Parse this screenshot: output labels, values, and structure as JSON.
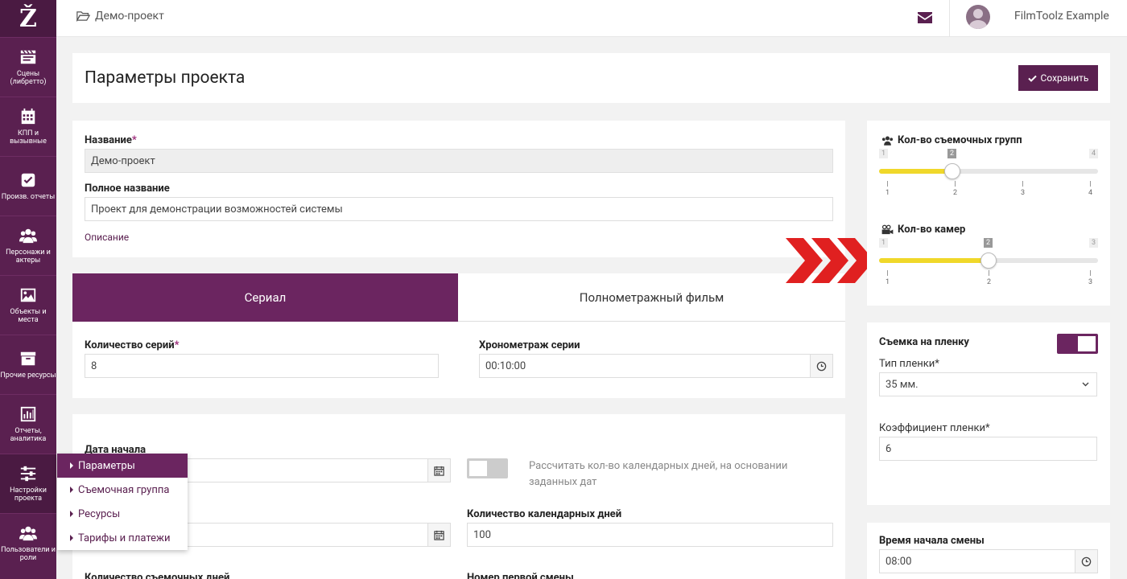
{
  "app": {
    "logo_letter": "Ž"
  },
  "sidebar": {
    "items": [
      {
        "icon": "clapperboard-icon",
        "label": "Сцены (либретто)"
      },
      {
        "icon": "calendar-icon",
        "label": "КПП и вызывные"
      },
      {
        "icon": "checkbox-icon",
        "label": "Произв. отчеты"
      },
      {
        "icon": "users-icon",
        "label": "Персонажи и актеры"
      },
      {
        "icon": "image-icon",
        "label": "Объекты и места"
      },
      {
        "icon": "archive-icon",
        "label": "Прочие ресурсы"
      },
      {
        "icon": "bar-chart-icon",
        "label": "Отчеты, аналитика"
      },
      {
        "icon": "sliders-icon",
        "label": "Настройки проекта"
      },
      {
        "icon": "users-icon",
        "label": "Пользователи и роли"
      }
    ]
  },
  "topbar": {
    "breadcrumb": "Демо-проект",
    "user_name": "FilmToolz Example"
  },
  "page": {
    "title": "Параметры проекта",
    "save_label": "Сохранить"
  },
  "project": {
    "name_label": "Название",
    "name_value": "Демо-проект",
    "fullname_label": "Полное название",
    "fullname_value": "Проект для демонстрации возможностей системы",
    "description_link": "Описание"
  },
  "tabs": [
    {
      "label": "Сериал",
      "active": true
    },
    {
      "label": "Полнометражный фильм",
      "active": false
    }
  ],
  "series": {
    "count_label": "Количество серий",
    "count_value": "8",
    "duration_label": "Хронометраж серии",
    "duration_value": "00:10:00"
  },
  "dates": {
    "start_label": "Дата начала",
    "calc_hint": "Рассчитать кол-во календарных дней, на основании заданных дат",
    "calc_toggle_on": false,
    "calendar_days_label": "Количество календарных дней",
    "calendar_days_value": "100",
    "shoot_days_label": "Количество съемочных дней",
    "first_shift_label": "Номер первой смены"
  },
  "dropdown": {
    "items": [
      "Параметры",
      "Съемочная группа",
      "Ресурсы",
      "Тарифы и платежи"
    ],
    "active_index": 0
  },
  "sliders": {
    "groups": {
      "label": "Кол-во съемочных групп",
      "min": 1,
      "max": 4,
      "value": 2,
      "ticks": [
        "1",
        "2",
        "3",
        "4"
      ],
      "min_label": "1",
      "max_label": "4",
      "value_label": "2"
    },
    "cameras": {
      "label": "Кол-во камер",
      "min": 1,
      "max": 3,
      "value": 2,
      "ticks": [
        "1",
        "2",
        "3"
      ],
      "min_label": "1",
      "max_label": "3",
      "value_label": "2"
    }
  },
  "film": {
    "shoot_on_film_label": "Съемка на пленку",
    "shoot_on_film_on": true,
    "film_type_label": "Тип пленки",
    "film_type_value": "35 мм.",
    "film_coef_label": "Коэффициент пленки",
    "film_coef_value": "6"
  },
  "shift": {
    "start_time_label": "Время начала смены",
    "start_time_value": "08:00"
  },
  "colors": {
    "primary": "#5a2050",
    "tab_active": "#6b2560",
    "slider_fill": "#f0d82a",
    "arrow": "#e02020"
  }
}
